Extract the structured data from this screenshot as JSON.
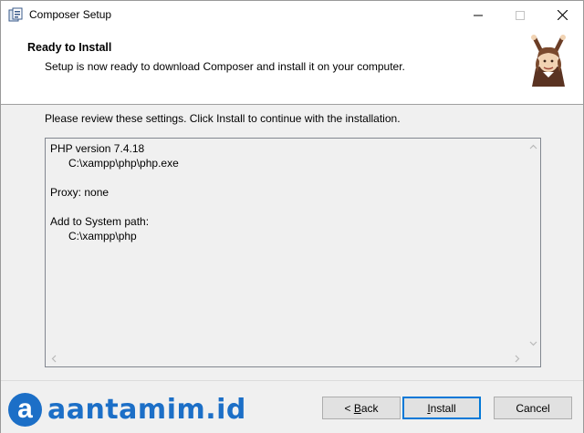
{
  "window": {
    "title": "Composer Setup"
  },
  "header": {
    "title": "Ready to Install",
    "subtitle": "Setup is now ready to download Composer and install it on your computer."
  },
  "main": {
    "instructions": "Please review these settings. Click Install to continue with the installation.",
    "settings_lines": [
      "PHP version 7.4.18",
      "      C:\\xampp\\php\\php.exe",
      "",
      "Proxy: none",
      "",
      "Add to System path:",
      "      C:\\xampp\\php"
    ]
  },
  "footer": {
    "brand_letter": "a",
    "brand_text": "aantamim.id",
    "back_prefix": "< ",
    "back_access": "B",
    "back_rest": "ack",
    "install_access": "I",
    "install_rest": "nstall",
    "cancel_label": "Cancel"
  },
  "colors": {
    "accent": "#0078d7",
    "brand": "#1c6fc7"
  }
}
